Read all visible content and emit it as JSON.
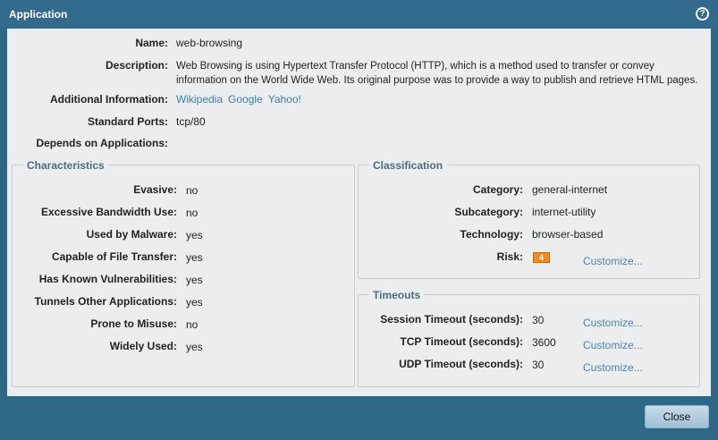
{
  "dialog": {
    "title": "Application",
    "help_icon": "help-icon"
  },
  "general": [
    {
      "label": "Name:",
      "value": "web-browsing"
    },
    {
      "label": "Description:",
      "value": "Web Browsing is using Hypertext Transfer Protocol (HTTP), which is a method used to transfer or convey information on the World Wide Web. Its original purpose was to provide a way to publish and retrieve HTML pages."
    },
    {
      "label": "Additional Information:",
      "links": [
        "Wikipedia",
        "Google",
        "Yahoo!"
      ]
    },
    {
      "label": "Standard Ports:",
      "value": "tcp/80"
    },
    {
      "label": "Depends on Applications:",
      "value": ""
    }
  ],
  "characteristics": {
    "title": "Characteristics",
    "rows": [
      {
        "label": "Evasive:",
        "value": "no"
      },
      {
        "label": "Excessive Bandwidth Use:",
        "value": "no"
      },
      {
        "label": "Used by Malware:",
        "value": "yes"
      },
      {
        "label": "Capable of File Transfer:",
        "value": "yes"
      },
      {
        "label": "Has Known Vulnerabilities:",
        "value": "yes"
      },
      {
        "label": "Tunnels Other Applications:",
        "value": "yes"
      },
      {
        "label": "Prone to Misuse:",
        "value": "no"
      },
      {
        "label": "Widely Used:",
        "value": "yes"
      }
    ]
  },
  "classification": {
    "title": "Classification",
    "rows": [
      {
        "label": "Category:",
        "value": "general-internet"
      },
      {
        "label": "Subcategory:",
        "value": "internet-utility"
      },
      {
        "label": "Technology:",
        "value": "browser-based"
      },
      {
        "label": "Risk:",
        "value": "4"
      }
    ],
    "customize": "Customize...",
    "risk_color": "#f08a1c"
  },
  "timeouts": {
    "title": "Timeouts",
    "rows": [
      {
        "label": "Session Timeout (seconds):",
        "value": "30",
        "customize": "Customize..."
      },
      {
        "label": "TCP Timeout (seconds):",
        "value": "3600",
        "customize": "Customize..."
      },
      {
        "label": "UDP Timeout (seconds):",
        "value": "30",
        "customize": "Customize..."
      }
    ]
  },
  "footer": {
    "close": "Close"
  }
}
